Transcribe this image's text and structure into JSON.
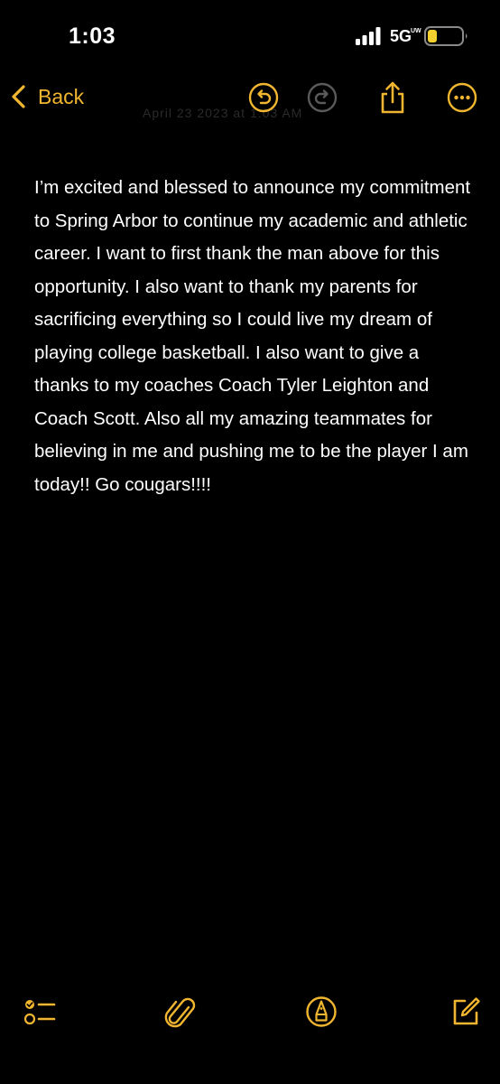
{
  "status_bar": {
    "time": "1:03",
    "network": "5G",
    "network_sub": "UW"
  },
  "nav": {
    "back_label": "Back",
    "faded_title": "April 23 2023 at 1:03 AM"
  },
  "icons": {
    "back": "chevron-left-icon",
    "undo": "undo-icon",
    "redo": "redo-icon",
    "share": "share-icon",
    "more": "more-icon",
    "checklist": "checklist-icon",
    "attachment": "paperclip-icon",
    "markup": "markup-pen-icon",
    "compose": "compose-icon"
  },
  "colors": {
    "accent": "#f1b62f",
    "background": "#000000",
    "text": "#ffffff",
    "disabled": "#5a5a5a"
  },
  "note": {
    "body": "I’m excited and blessed to announce my commitment to Spring Arbor to continue my academic and athletic career. I want to first thank the man above for this opportunity. I also want to thank my parents for sacrificing everything so I could live my dream of playing college basketball. I also want to give a thanks to my coaches Coach Tyler Leighton and Coach Scott. Also all my amazing teammates for believing in me and pushing me to be the player I am today!! Go cougars!!!!"
  }
}
